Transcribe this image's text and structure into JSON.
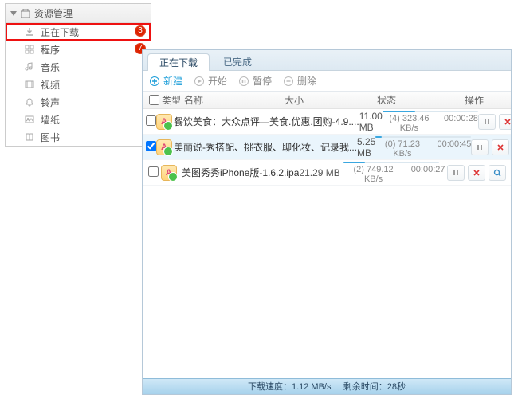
{
  "sidebar": {
    "title": "资源管理",
    "items": [
      {
        "label": "正在下载",
        "badge": "3",
        "icon": "download-icon",
        "active": true
      },
      {
        "label": "程序",
        "badge": "7",
        "icon": "grid-icon"
      },
      {
        "label": "音乐",
        "icon": "music-icon"
      },
      {
        "label": "视频",
        "icon": "film-icon"
      },
      {
        "label": "铃声",
        "icon": "bell-icon"
      },
      {
        "label": "墙纸",
        "icon": "image-icon"
      },
      {
        "label": "图书",
        "icon": "book-icon"
      }
    ]
  },
  "tabs": {
    "downloading": "正在下载",
    "done": "已完成"
  },
  "toolbar": {
    "new": "新建",
    "start": "开始",
    "pause": "暂停",
    "delete": "删除"
  },
  "columns": {
    "type": "类型",
    "name": "名称",
    "size": "大小",
    "status": "状态",
    "ops": "操作"
  },
  "rows": [
    {
      "name": "餐饮美食：大众点评—美食.优惠.团购-4.9....",
      "size": "11.00 MB",
      "segments": "(4)",
      "speed": "323.46 KB/s",
      "time": "00:00:28",
      "progress_pct": 34,
      "checked": false,
      "selected": false
    },
    {
      "name": "美丽说-秀搭配、挑衣服、聊化妆、记录我...",
      "size": "5.25 MB",
      "segments": "(0)",
      "speed": "71.23 KB/s",
      "time": "00:00:45",
      "progress_pct": 6,
      "checked": true,
      "selected": true
    },
    {
      "name": "美图秀秀iPhone版-1.6.2.ipa",
      "size": "21.29 MB",
      "segments": "(2)",
      "speed": "749.12 KB/s",
      "time": "00:00:27",
      "progress_pct": 22,
      "checked": false,
      "selected": false
    }
  ],
  "footer": {
    "speed_label": "下载速度：",
    "speed_value": "1.12 MB/s",
    "remain_label": "剩余时间：",
    "remain_value": "28秒"
  }
}
